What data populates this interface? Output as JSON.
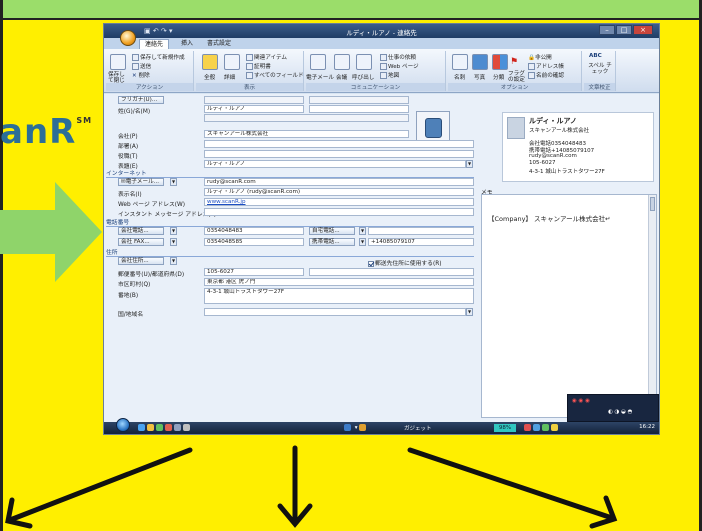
{
  "logo": {
    "text": "anR",
    "mark": "SM"
  },
  "window": {
    "title": "ルディ・ルアノ - 連絡先",
    "tabs": [
      "連絡先",
      "挿入",
      "書式設定"
    ],
    "ribbon": {
      "actions": {
        "save_close": "保存して閉じる",
        "save_new": "保存して新規作成",
        "send": "送信",
        "delete": "削除",
        "label": "アクション"
      },
      "show": {
        "general": "全般",
        "details": "詳細",
        "related": "関連アイテム",
        "certs": "証明書",
        "allfields": "すべてのフィールド",
        "label": "表示"
      },
      "communicate": {
        "email": "電子メール",
        "meeting": "会議",
        "call": "呼び出し",
        "assign_task": "仕事の依頼",
        "webpage": "Web ページ",
        "map": "地図",
        "label": "コミュニケーション"
      },
      "options": {
        "card": "名刺",
        "picture": "写真",
        "categorize": "分類",
        "followup": "フラグの設定",
        "private": "非公開",
        "address_book": "アドレス帳",
        "check_names": "名前の確認",
        "label": "オプション"
      },
      "proofing": {
        "spelling": "スペル チェック",
        "label": "文章校正"
      }
    },
    "form": {
      "furigana_btn": "フリガナ(U)...",
      "fullname_lbl": "姓(G)/名(M)",
      "fullname": "ルディ・ルアノ",
      "company_lbl": "会社(P)",
      "company": "スキャンアール株式会社",
      "dept_lbl": "部署(A)",
      "title_lbl": "役職(T)",
      "fileas_lbl": "表題(E)",
      "fileas": "ルディ・ルアノ",
      "internet": "インターネット",
      "email_btn": "電子メール...",
      "email": "rudy@scanR.com",
      "display_lbl": "表示名(I)",
      "display": "ルディ・ルアノ (rudy@scanR.com)",
      "web_lbl": "Web ページ アドレス(W)",
      "web": "www.scanR.jp",
      "im_lbl": "インスタント メッセージ アドレス(L)",
      "phone_sec": "電話番号",
      "work_phone_btn": "会社電話...",
      "work_phone": "0354048483",
      "home_phone_btn": "自宅電話...",
      "work_fax_btn": "会社 FAX...",
      "work_fax": "0354048585",
      "mobile_btn": "携帯電話...",
      "mobile": "+14085079107",
      "address_sec": "住所",
      "addr_btn": "会社住所...",
      "mailing_lbl": "郵送先住所に使用する(R)",
      "zip_lbl": "郵便番号(U)/都道府県(D)",
      "zip": "105-6027",
      "city_lbl": "市区町村(Q)",
      "city": "東京都 港区 虎ノ門",
      "street_lbl": "番地(B)",
      "street": "4-3-1 城山トラストタワー27F",
      "country_lbl": "国/地域名"
    },
    "card": {
      "name": "ルディ・ルアノ",
      "company": "スキャンアール株式会社",
      "lines": [
        "会社電話0354048483",
        "携帯電話+14085079107",
        "rudy@scanR.com",
        "105-6027",
        "4-3-1 城山トラストタワー27F"
      ]
    },
    "memo_lbl": "メモ",
    "memo": "【Company】 スキャンアール株式会社↵",
    "taskbar": {
      "gadget_label": "ガジェット",
      "battery": "98%",
      "time": "16:22"
    }
  }
}
